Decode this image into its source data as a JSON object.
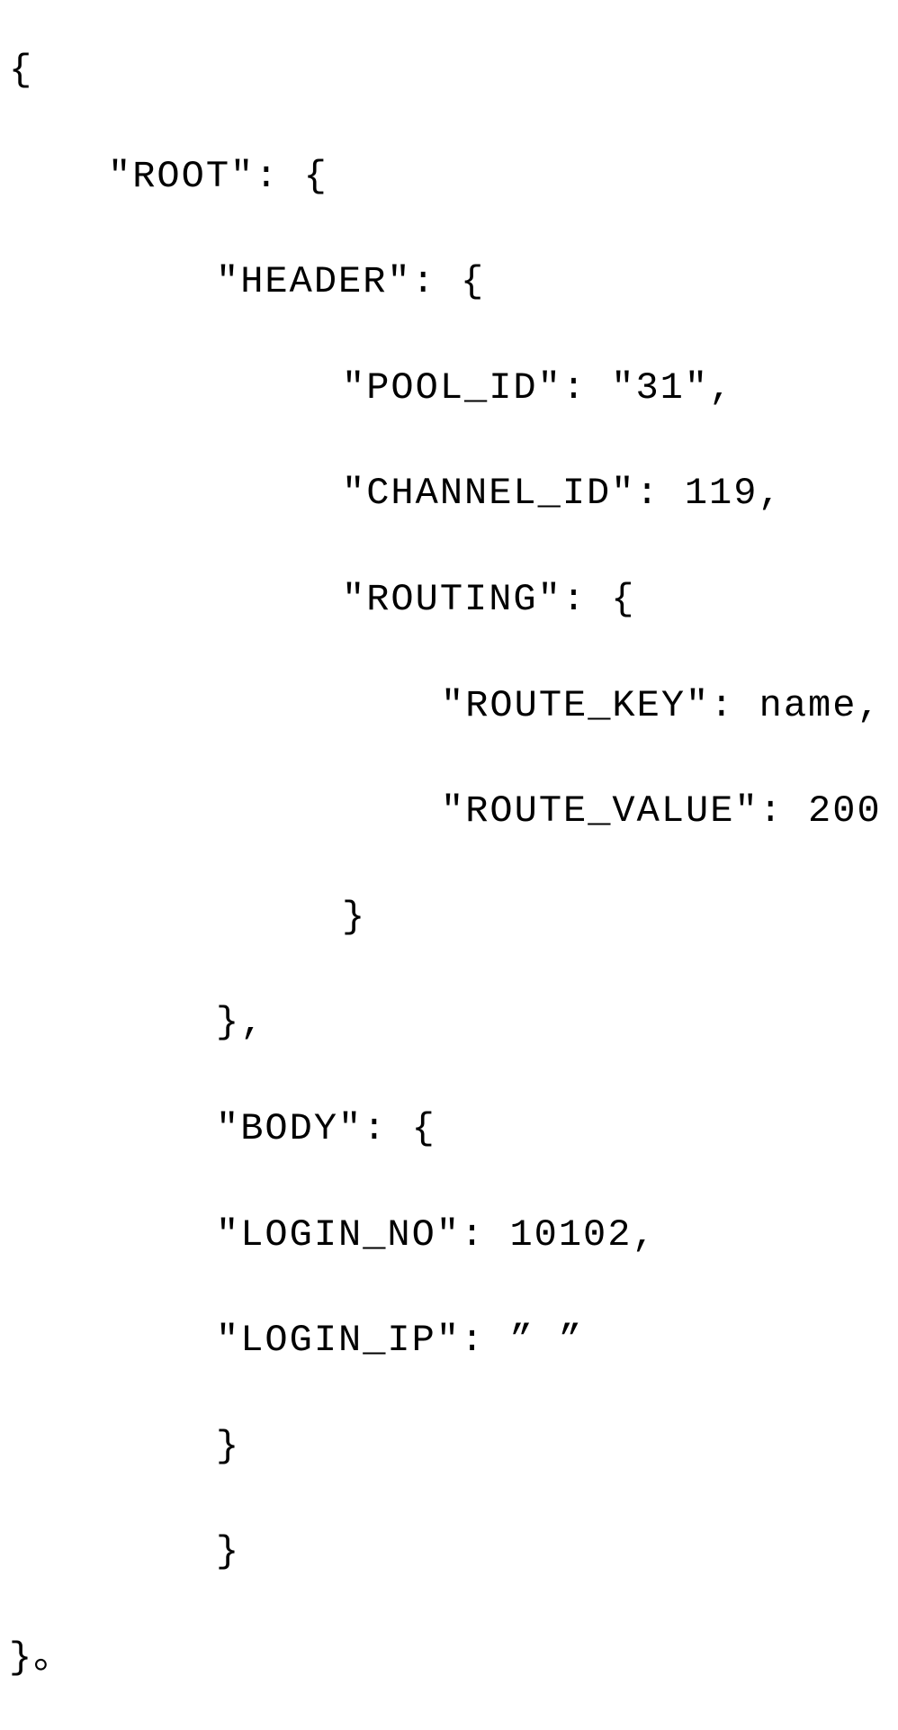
{
  "code": {
    "l1": "{",
    "l2": "\"ROOT\": {",
    "l3": "\"HEADER\": {",
    "l4": "\"POOL_ID\": \"31\",",
    "l5": "\"CHANNEL_ID\": 119,",
    "l6": "\"ROUTING\": {",
    "l7": "\"ROUTE_KEY\": name,",
    "l8": "\"ROUTE_VALUE\": 200",
    "l9": "}",
    "l10": "},",
    "l11": "\"BODY\": {",
    "l12": "\"LOGIN_NO\": 10102,",
    "l13": "\"LOGIN_IP\": ” ”",
    "l14": "}",
    "l15": "}",
    "l16": "}。"
  }
}
